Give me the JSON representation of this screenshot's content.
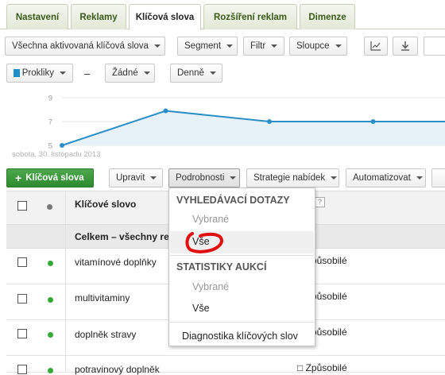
{
  "tabs": [
    {
      "label": "Nastavení"
    },
    {
      "label": "Reklamy"
    },
    {
      "label": "Klíčová slova",
      "active": true
    },
    {
      "label": "Rozšíření reklam"
    },
    {
      "label": "Dimenze"
    }
  ],
  "toolbar": {
    "filter_all": "Všechna aktivovaná klíčová slova",
    "segment": "Segment",
    "filter": "Filtr",
    "columns": "Sloupce"
  },
  "chart_controls": {
    "metric1": "Prokliky",
    "separator": "–",
    "metric2": "Žádné",
    "period": "Denně"
  },
  "chart_data": {
    "type": "line",
    "series": [
      {
        "values": [
          5,
          7.9,
          7,
          7,
          7
        ]
      }
    ],
    "y_ticks": [
      "9",
      "7",
      "5"
    ],
    "ylim": [
      5,
      9
    ],
    "date_label": "sobota, 30. listopadu 2013",
    "color": "#2a8fc6"
  },
  "actions": {
    "add_keyword": "Klíčová slova",
    "edit": "Upravit",
    "details": "Podrobnosti",
    "bid_strategy": "Strategie nabídek",
    "automate": "Automatizovat"
  },
  "table": {
    "header_keyword": "Klíčové slovo",
    "header_help": "?",
    "total_row": "Celkem – všechny re",
    "rows": [
      {
        "keyword": "vitamínové doplňky",
        "status": "Způsobilé"
      },
      {
        "keyword": "multivitaminy",
        "status": "Způsobilé"
      },
      {
        "keyword": "doplněk stravy",
        "status": "Způsobilé"
      },
      {
        "keyword": "potravinový doplněk",
        "status": "Způsobilé"
      }
    ]
  },
  "menu": {
    "search_queries_header": "VYHLEDÁVACÍ DOTAZY",
    "sq_selected": "Vybrané",
    "sq_all": "Vše",
    "auction_header": "STATISTIKY AUKCÍ",
    "au_selected": "Vybrané",
    "au_all": "Vše",
    "diagnostics": "Diagnostika klíčových slov"
  },
  "colors": {
    "accent_green": "#2e8a2e",
    "chart_line": "#2a8fc6",
    "annotation_red": "#e01010"
  }
}
